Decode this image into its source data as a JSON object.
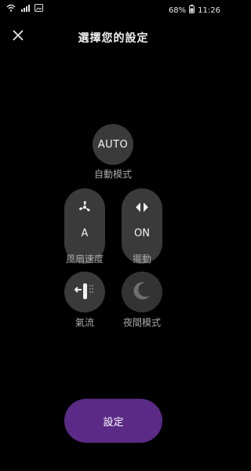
{
  "status_bar": {
    "battery": "68%",
    "time": "11:26"
  },
  "header": {
    "title": "選擇您的設定"
  },
  "modes": {
    "auto": {
      "value": "AUTO",
      "label": "自動模式"
    },
    "fan_speed": {
      "value": "A",
      "label": "風扇速度"
    },
    "oscillation": {
      "value": "ON",
      "label": "擺動"
    },
    "airflow": {
      "label": "氣流"
    },
    "night": {
      "label": "夜間模式"
    }
  },
  "actions": {
    "set_label": "設定"
  },
  "colors": {
    "background": "#000000",
    "control": "#3a3a3a",
    "accent": "#5b2a86"
  },
  "icons": [
    "wifi-icon",
    "signal-icon",
    "image-icon",
    "battery-icon",
    "close-icon",
    "fan-icon",
    "oscillate-arrows-icon",
    "airflow-icon",
    "moon-icon"
  ]
}
